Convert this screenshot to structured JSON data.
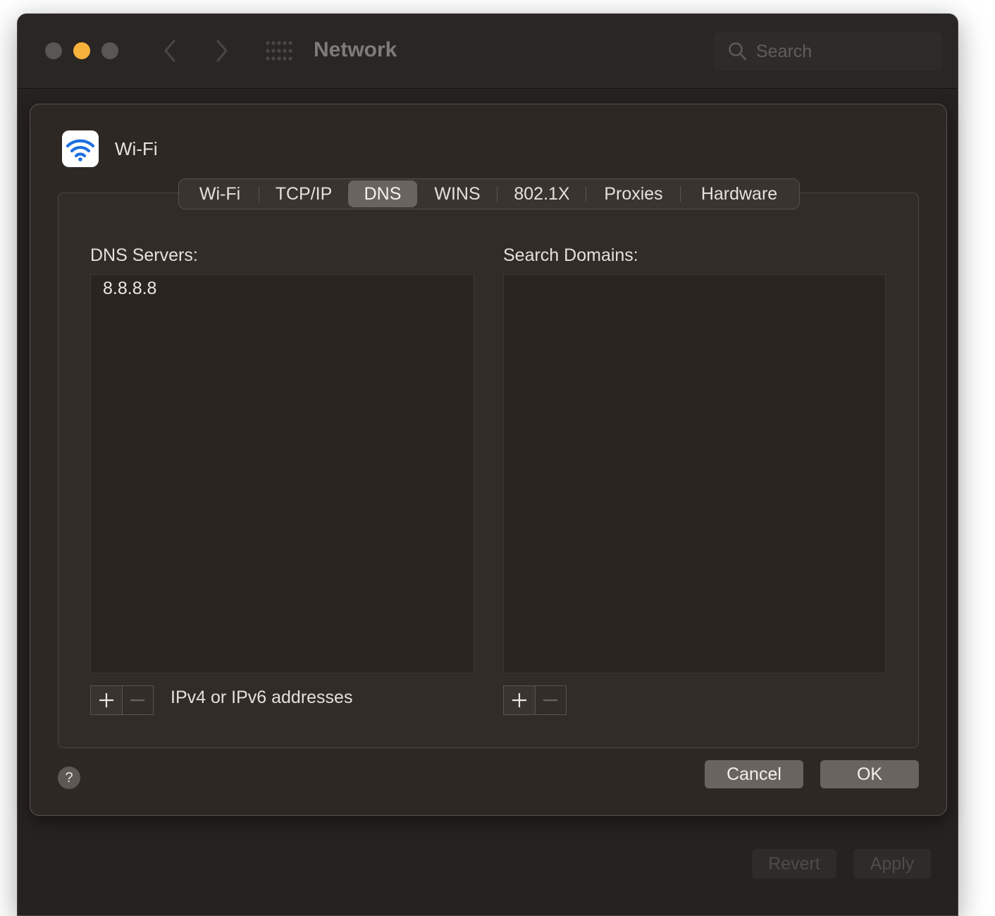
{
  "window": {
    "title": "Network",
    "search_placeholder": "Search",
    "footer": {
      "revert_label": "Revert",
      "apply_label": "Apply"
    }
  },
  "sheet": {
    "service_name": "Wi-Fi",
    "tabs": [
      {
        "label": "Wi-Fi"
      },
      {
        "label": "TCP/IP"
      },
      {
        "label": "DNS"
      },
      {
        "label": "WINS"
      },
      {
        "label": "802.1X"
      },
      {
        "label": "Proxies"
      },
      {
        "label": "Hardware"
      }
    ],
    "active_tab": "DNS",
    "dns": {
      "label": "DNS Servers:",
      "servers": [
        "8.8.8.8"
      ],
      "hint": "IPv4 or IPv6 addresses"
    },
    "search_domains": {
      "label": "Search Domains:",
      "domains": []
    },
    "help_label": "?",
    "cancel_label": "Cancel",
    "ok_label": "OK"
  },
  "colors": {
    "window_bg": "#262220",
    "sheet_bg": "#2e2825",
    "accent_wifi": "#1e6fe0",
    "traffic_minimize": "#f6b23b"
  }
}
